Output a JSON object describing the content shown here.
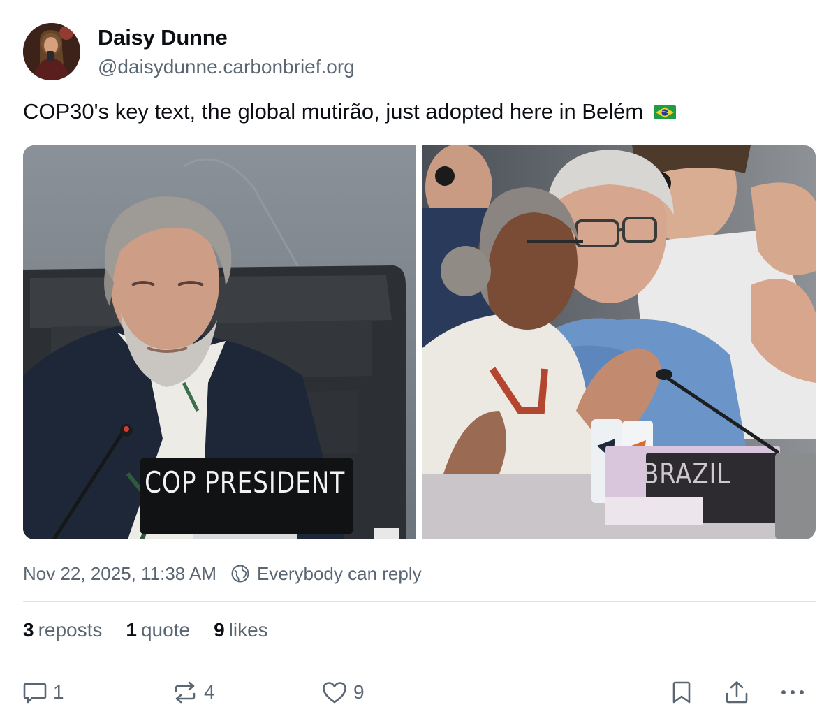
{
  "author": {
    "display_name": "Daisy Dunne",
    "handle": "@daisydunne.carbonbrief.org",
    "avatar_icon": "profile-photo"
  },
  "post": {
    "text": "COP30's key text, the global mutirão, just adopted here in Belém",
    "flag_icon": "brazil-flag-emoji",
    "images": [
      {
        "nameplate": "COP PRESIDENT"
      },
      {
        "nameplate": "BRAZIL"
      }
    ]
  },
  "meta": {
    "timestamp": "Nov 22, 2025, 11:38 AM",
    "reply_setting": "Everybody can reply"
  },
  "stats": {
    "reposts_count": "3",
    "reposts_label": "reposts",
    "quotes_count": "1",
    "quotes_label": "quote",
    "likes_count": "9",
    "likes_label": "likes"
  },
  "actions": {
    "reply_count": "1",
    "repost_count": "4",
    "like_count": "9"
  },
  "colors": {
    "text_primary": "#0b0f14",
    "text_secondary": "#5b6673",
    "divider": "#dfe3e8"
  }
}
